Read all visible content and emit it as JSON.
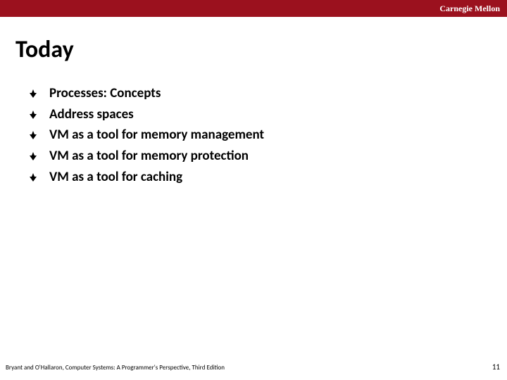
{
  "banner": {
    "brand": "Carnegie Mellon"
  },
  "title": "Today",
  "bullets": [
    "Processes: Concepts",
    "Address spaces",
    "VM as a tool for memory management",
    "VM as a tool for memory protection",
    "VM as a tool for caching"
  ],
  "footer": {
    "left": "Bryant and O'Hallaron, Computer Systems: A Programmer's Perspective, Third Edition",
    "page": "11"
  },
  "colors": {
    "banner": "#9b111e"
  }
}
